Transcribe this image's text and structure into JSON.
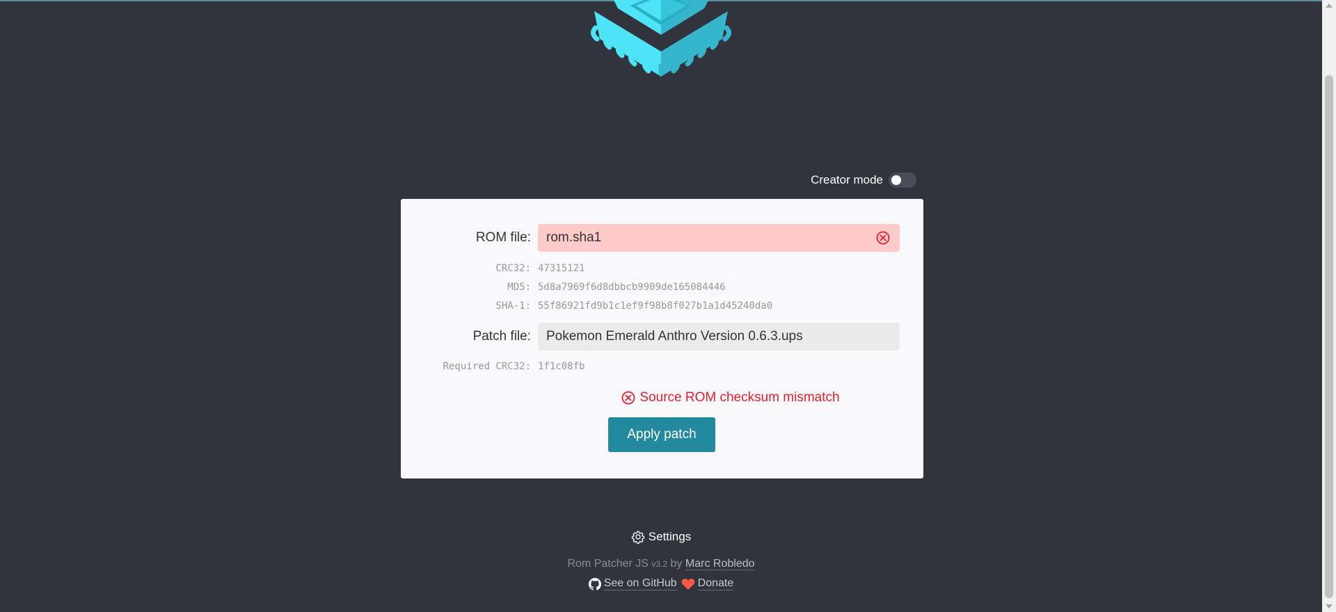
{
  "app": {
    "logo_icon": "chip-icon",
    "accent_color": "#23899f",
    "error_color": "#e21d2e"
  },
  "creator_mode": {
    "label": "Creator mode",
    "enabled": false
  },
  "rom": {
    "label": "ROM file:",
    "value": "rom.sha1",
    "state": "error",
    "hashes": [
      {
        "label": "CRC32:",
        "value": "47315121"
      },
      {
        "label": "MD5:",
        "value": "5d8a7969f6d8dbbcb9909de165084446"
      },
      {
        "label": "SHA-1:",
        "value": "55f86921fd9b1c1ef9f98b8f027b1a1d45240da0"
      }
    ]
  },
  "patch": {
    "label": "Patch file:",
    "value": "Pokemon Emerald Anthro Version 0.6.3.ups",
    "required_label": "Required CRC32:",
    "required_value": "1f1c08fb"
  },
  "status": {
    "error_message": "Source ROM checksum mismatch"
  },
  "actions": {
    "apply_label": "Apply patch"
  },
  "footer": {
    "settings_label": "Settings",
    "app_name": "Rom Patcher JS",
    "version": "v3.2",
    "by": "by",
    "author": "Marc Robledo",
    "github_label": "See on GitHub",
    "donate_label": "Donate"
  }
}
